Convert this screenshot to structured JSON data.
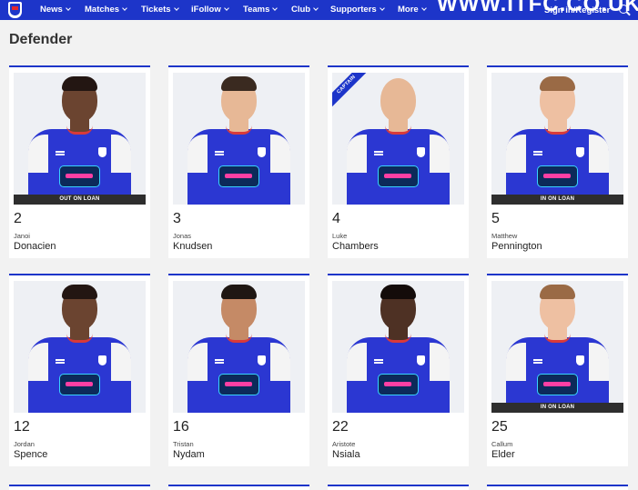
{
  "nav": {
    "items": [
      {
        "label": "News"
      },
      {
        "label": "Matches"
      },
      {
        "label": "Tickets"
      },
      {
        "label": "iFollow"
      },
      {
        "label": "Teams"
      },
      {
        "label": "Club"
      },
      {
        "label": "Supporters"
      },
      {
        "label": "More"
      }
    ],
    "site_url": "WWW.ITFC.CO.UK",
    "signin_label": "Sign in/Register",
    "brand_color": "#1d35c9"
  },
  "section": {
    "title": "Defender"
  },
  "players": [
    {
      "number": "2",
      "first_name": "Janoi",
      "last_name": "Donacien",
      "status": "OUT ON LOAN",
      "captain": ""
    },
    {
      "number": "3",
      "first_name": "Jonas",
      "last_name": "Knudsen",
      "status": "",
      "captain": ""
    },
    {
      "number": "4",
      "first_name": "Luke",
      "last_name": "Chambers",
      "status": "",
      "captain": "CAPTAIN"
    },
    {
      "number": "5",
      "first_name": "Matthew",
      "last_name": "Pennington",
      "status": "IN ON LOAN",
      "captain": ""
    },
    {
      "number": "12",
      "first_name": "Jordan",
      "last_name": "Spence",
      "status": "",
      "captain": ""
    },
    {
      "number": "16",
      "first_name": "Tristan",
      "last_name": "Nydam",
      "status": "",
      "captain": ""
    },
    {
      "number": "22",
      "first_name": "Aristote",
      "last_name": "Nsiala",
      "status": "",
      "captain": ""
    },
    {
      "number": "25",
      "first_name": "Callum",
      "last_name": "Elder",
      "status": "IN ON LOAN",
      "captain": ""
    }
  ]
}
